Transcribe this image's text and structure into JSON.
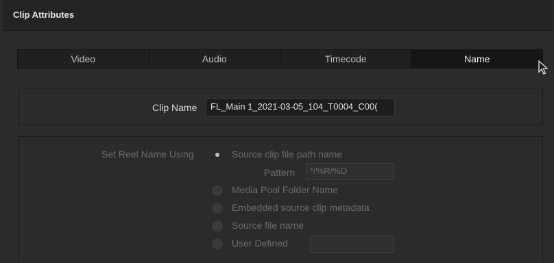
{
  "window": {
    "title": "Clip Attributes"
  },
  "tabs": [
    {
      "label": "Video",
      "active": false
    },
    {
      "label": "Audio",
      "active": false
    },
    {
      "label": "Timecode",
      "active": false
    },
    {
      "label": "Name",
      "active": true
    }
  ],
  "clip_name": {
    "label": "Clip Name",
    "value": "FL_Main 1_2021-03-05_104_T0004_C00("
  },
  "reel_name": {
    "label": "Set Reel Name Using",
    "options": [
      {
        "label": "Source clip file path name",
        "selected": true
      },
      {
        "label": "Media Pool Folder Name",
        "selected": false
      },
      {
        "label": "Embedded source clip metadata",
        "selected": false
      },
      {
        "label": "Source file name",
        "selected": false
      },
      {
        "label": "User Defined",
        "selected": false
      }
    ],
    "pattern_label": "Pattern",
    "pattern_value": "*/%R/%D",
    "user_defined_value": ""
  },
  "colors": {
    "background": "#2b2b2d",
    "active_tab": "#161618",
    "disabled_text": "#6b6b6d"
  }
}
